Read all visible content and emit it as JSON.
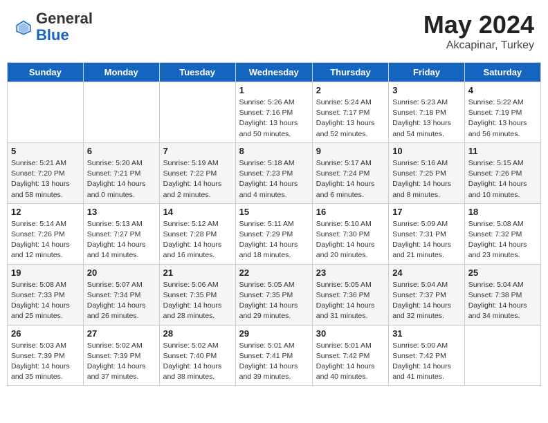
{
  "header": {
    "logo_general": "General",
    "logo_blue": "Blue",
    "title": "May 2024",
    "location": "Akcapinar, Turkey"
  },
  "weekdays": [
    "Sunday",
    "Monday",
    "Tuesday",
    "Wednesday",
    "Thursday",
    "Friday",
    "Saturday"
  ],
  "weeks": [
    [
      {
        "day": "",
        "info": ""
      },
      {
        "day": "",
        "info": ""
      },
      {
        "day": "",
        "info": ""
      },
      {
        "day": "1",
        "info": "Sunrise: 5:26 AM\nSunset: 7:16 PM\nDaylight: 13 hours\nand 50 minutes."
      },
      {
        "day": "2",
        "info": "Sunrise: 5:24 AM\nSunset: 7:17 PM\nDaylight: 13 hours\nand 52 minutes."
      },
      {
        "day": "3",
        "info": "Sunrise: 5:23 AM\nSunset: 7:18 PM\nDaylight: 13 hours\nand 54 minutes."
      },
      {
        "day": "4",
        "info": "Sunrise: 5:22 AM\nSunset: 7:19 PM\nDaylight: 13 hours\nand 56 minutes."
      }
    ],
    [
      {
        "day": "5",
        "info": "Sunrise: 5:21 AM\nSunset: 7:20 PM\nDaylight: 13 hours\nand 58 minutes."
      },
      {
        "day": "6",
        "info": "Sunrise: 5:20 AM\nSunset: 7:21 PM\nDaylight: 14 hours\nand 0 minutes."
      },
      {
        "day": "7",
        "info": "Sunrise: 5:19 AM\nSunset: 7:22 PM\nDaylight: 14 hours\nand 2 minutes."
      },
      {
        "day": "8",
        "info": "Sunrise: 5:18 AM\nSunset: 7:23 PM\nDaylight: 14 hours\nand 4 minutes."
      },
      {
        "day": "9",
        "info": "Sunrise: 5:17 AM\nSunset: 7:24 PM\nDaylight: 14 hours\nand 6 minutes."
      },
      {
        "day": "10",
        "info": "Sunrise: 5:16 AM\nSunset: 7:25 PM\nDaylight: 14 hours\nand 8 minutes."
      },
      {
        "day": "11",
        "info": "Sunrise: 5:15 AM\nSunset: 7:26 PM\nDaylight: 14 hours\nand 10 minutes."
      }
    ],
    [
      {
        "day": "12",
        "info": "Sunrise: 5:14 AM\nSunset: 7:26 PM\nDaylight: 14 hours\nand 12 minutes."
      },
      {
        "day": "13",
        "info": "Sunrise: 5:13 AM\nSunset: 7:27 PM\nDaylight: 14 hours\nand 14 minutes."
      },
      {
        "day": "14",
        "info": "Sunrise: 5:12 AM\nSunset: 7:28 PM\nDaylight: 14 hours\nand 16 minutes."
      },
      {
        "day": "15",
        "info": "Sunrise: 5:11 AM\nSunset: 7:29 PM\nDaylight: 14 hours\nand 18 minutes."
      },
      {
        "day": "16",
        "info": "Sunrise: 5:10 AM\nSunset: 7:30 PM\nDaylight: 14 hours\nand 20 minutes."
      },
      {
        "day": "17",
        "info": "Sunrise: 5:09 AM\nSunset: 7:31 PM\nDaylight: 14 hours\nand 21 minutes."
      },
      {
        "day": "18",
        "info": "Sunrise: 5:08 AM\nSunset: 7:32 PM\nDaylight: 14 hours\nand 23 minutes."
      }
    ],
    [
      {
        "day": "19",
        "info": "Sunrise: 5:08 AM\nSunset: 7:33 PM\nDaylight: 14 hours\nand 25 minutes."
      },
      {
        "day": "20",
        "info": "Sunrise: 5:07 AM\nSunset: 7:34 PM\nDaylight: 14 hours\nand 26 minutes."
      },
      {
        "day": "21",
        "info": "Sunrise: 5:06 AM\nSunset: 7:35 PM\nDaylight: 14 hours\nand 28 minutes."
      },
      {
        "day": "22",
        "info": "Sunrise: 5:05 AM\nSunset: 7:35 PM\nDaylight: 14 hours\nand 29 minutes."
      },
      {
        "day": "23",
        "info": "Sunrise: 5:05 AM\nSunset: 7:36 PM\nDaylight: 14 hours\nand 31 minutes."
      },
      {
        "day": "24",
        "info": "Sunrise: 5:04 AM\nSunset: 7:37 PM\nDaylight: 14 hours\nand 32 minutes."
      },
      {
        "day": "25",
        "info": "Sunrise: 5:04 AM\nSunset: 7:38 PM\nDaylight: 14 hours\nand 34 minutes."
      }
    ],
    [
      {
        "day": "26",
        "info": "Sunrise: 5:03 AM\nSunset: 7:39 PM\nDaylight: 14 hours\nand 35 minutes."
      },
      {
        "day": "27",
        "info": "Sunrise: 5:02 AM\nSunset: 7:39 PM\nDaylight: 14 hours\nand 37 minutes."
      },
      {
        "day": "28",
        "info": "Sunrise: 5:02 AM\nSunset: 7:40 PM\nDaylight: 14 hours\nand 38 minutes."
      },
      {
        "day": "29",
        "info": "Sunrise: 5:01 AM\nSunset: 7:41 PM\nDaylight: 14 hours\nand 39 minutes."
      },
      {
        "day": "30",
        "info": "Sunrise: 5:01 AM\nSunset: 7:42 PM\nDaylight: 14 hours\nand 40 minutes."
      },
      {
        "day": "31",
        "info": "Sunrise: 5:00 AM\nSunset: 7:42 PM\nDaylight: 14 hours\nand 41 minutes."
      },
      {
        "day": "",
        "info": ""
      }
    ]
  ]
}
